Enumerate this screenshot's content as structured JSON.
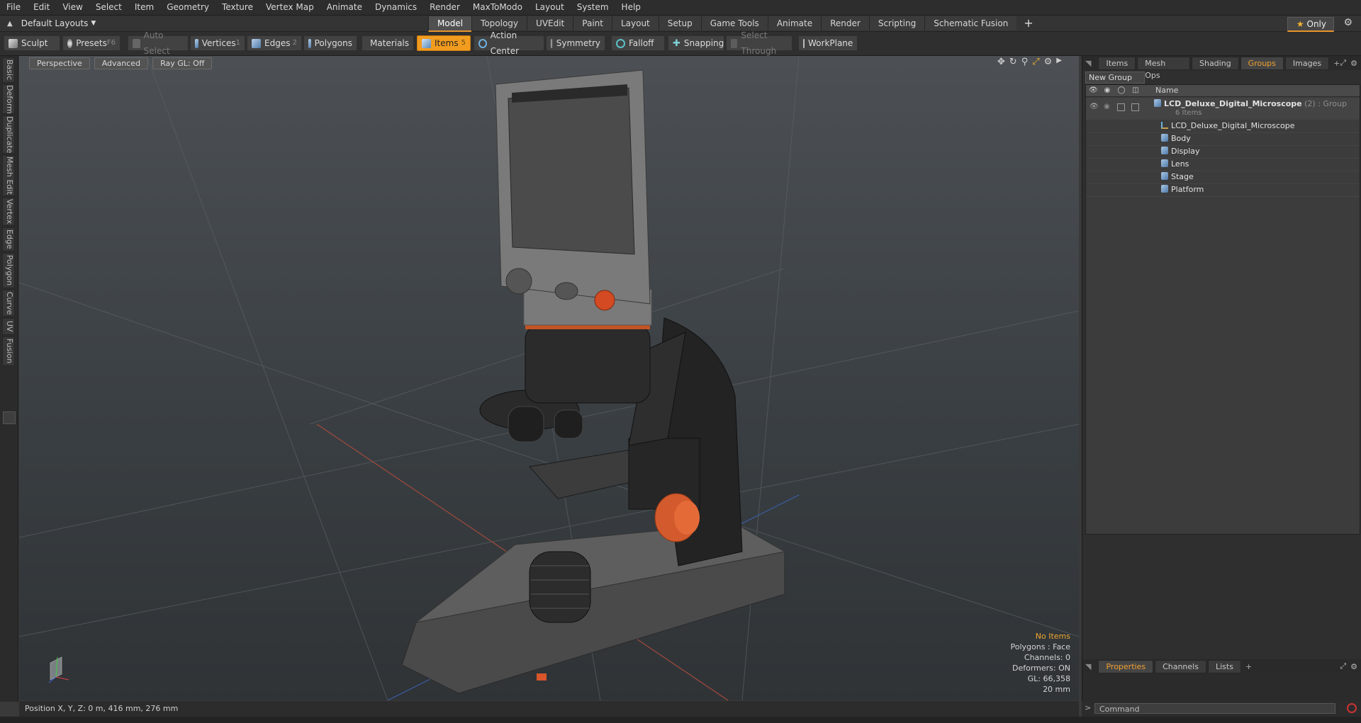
{
  "menu": [
    "File",
    "Edit",
    "View",
    "Select",
    "Item",
    "Geometry",
    "Texture",
    "Vertex Map",
    "Animate",
    "Dynamics",
    "Render",
    "MaxToModo",
    "Layout",
    "System",
    "Help"
  ],
  "layouts": {
    "current": "Default Layouts"
  },
  "tabs": [
    "Model",
    "Topology",
    "UVEdit",
    "Paint",
    "Layout",
    "Setup",
    "Game Tools",
    "Animate",
    "Render",
    "Scripting",
    "Schematic Fusion"
  ],
  "active_tab": "Model",
  "only_label": "Only",
  "toolbar": {
    "sculpt": "Sculpt",
    "presets": "Presets",
    "presets_key": "F6",
    "auto_select": "Auto Select",
    "vertices": "Vertices",
    "vertices_key": "1",
    "edges": "Edges",
    "edges_key": "2",
    "polygons": "Polygons",
    "materials": "Materials",
    "items": "Items",
    "items_key": "5",
    "action_center": "Action Center",
    "symmetry": "Symmetry",
    "falloff": "Falloff",
    "snapping": "Snapping",
    "select_through": "Select Through",
    "workplane": "WorkPlane"
  },
  "left_tabs": [
    "Basic",
    "Deform",
    "Duplicate",
    "Mesh Edit",
    "Vertex",
    "Edge",
    "Polygon",
    "Curve",
    "UV",
    "Fusion"
  ],
  "viewport": {
    "view": "Perspective",
    "shading": "Advanced",
    "raygl": "Ray GL: Off",
    "hud": {
      "selection": "No Items",
      "polygons": "Polygons : Face",
      "channels": "Channels: 0",
      "deformers": "Deformers: ON",
      "gl": "GL: 66,358",
      "scale": "20 mm"
    }
  },
  "right_tabs": [
    "Items",
    "Mesh Ops",
    "Shading",
    "Groups",
    "Images"
  ],
  "active_right_tab": "Groups",
  "new_group": "New Group",
  "list_header": "Name",
  "group": {
    "name": "LCD_Deluxe_Digital_Microscope",
    "count": "(2)",
    "type": ": Group",
    "items_count": "6 Items"
  },
  "group_items": [
    {
      "name": "LCD_Deluxe_Digital_Microscope",
      "icon": "locator-icon"
    },
    {
      "name": "Body",
      "icon": "mesh-icon"
    },
    {
      "name": "Display",
      "icon": "mesh-icon"
    },
    {
      "name": "Lens",
      "icon": "mesh-icon"
    },
    {
      "name": "Stage",
      "icon": "mesh-icon"
    },
    {
      "name": "Platform",
      "icon": "mesh-icon"
    }
  ],
  "bottom_tabs": [
    "Properties",
    "Channels",
    "Lists"
  ],
  "active_bottom_tab": "Properties",
  "status": {
    "position": "Position X, Y, Z:  0 m, 416 mm, 276 mm"
  },
  "command_placeholder": "Command",
  "colors": {
    "accent": "#f29c1f",
    "background": "#3a3a3a",
    "viewport_top": "#4c5054",
    "viewport_bottom": "#2f3336"
  }
}
